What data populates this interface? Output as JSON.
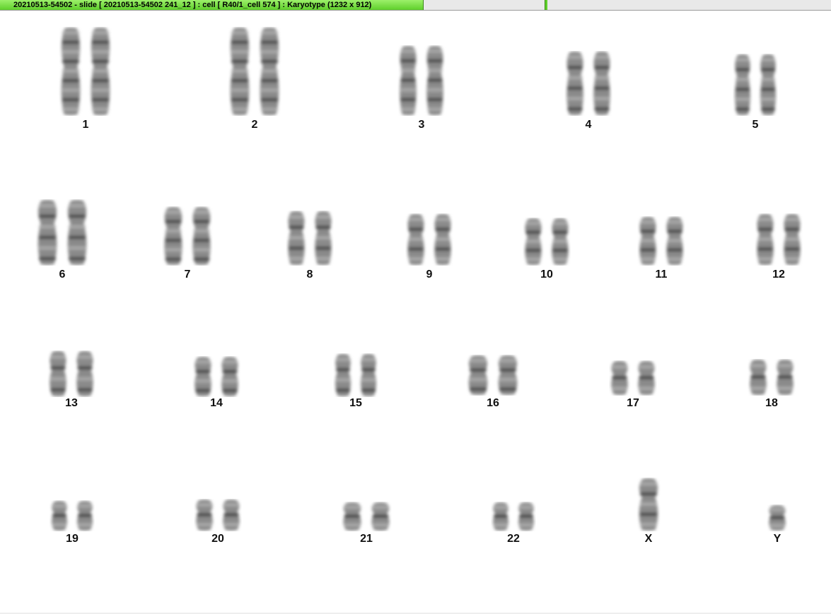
{
  "window": {
    "title": "20210513-54502 - slide [ 20210513-54502 241_12 ] : cell [ R40/1_cell 574 ] : Karyotype  (1232 x 912)"
  },
  "karyotype": {
    "pairs": [
      {
        "label": "1"
      },
      {
        "label": "2"
      },
      {
        "label": "3"
      },
      {
        "label": "4"
      },
      {
        "label": "5"
      },
      {
        "label": "6"
      },
      {
        "label": "7"
      },
      {
        "label": "8"
      },
      {
        "label": "9"
      },
      {
        "label": "10"
      },
      {
        "label": "11"
      },
      {
        "label": "12"
      },
      {
        "label": "13"
      },
      {
        "label": "14"
      },
      {
        "label": "15"
      },
      {
        "label": "16"
      },
      {
        "label": "17"
      },
      {
        "label": "18"
      },
      {
        "label": "19"
      },
      {
        "label": "20"
      },
      {
        "label": "21"
      },
      {
        "label": "22"
      },
      {
        "label": "X"
      },
      {
        "label": "Y"
      }
    ]
  }
}
